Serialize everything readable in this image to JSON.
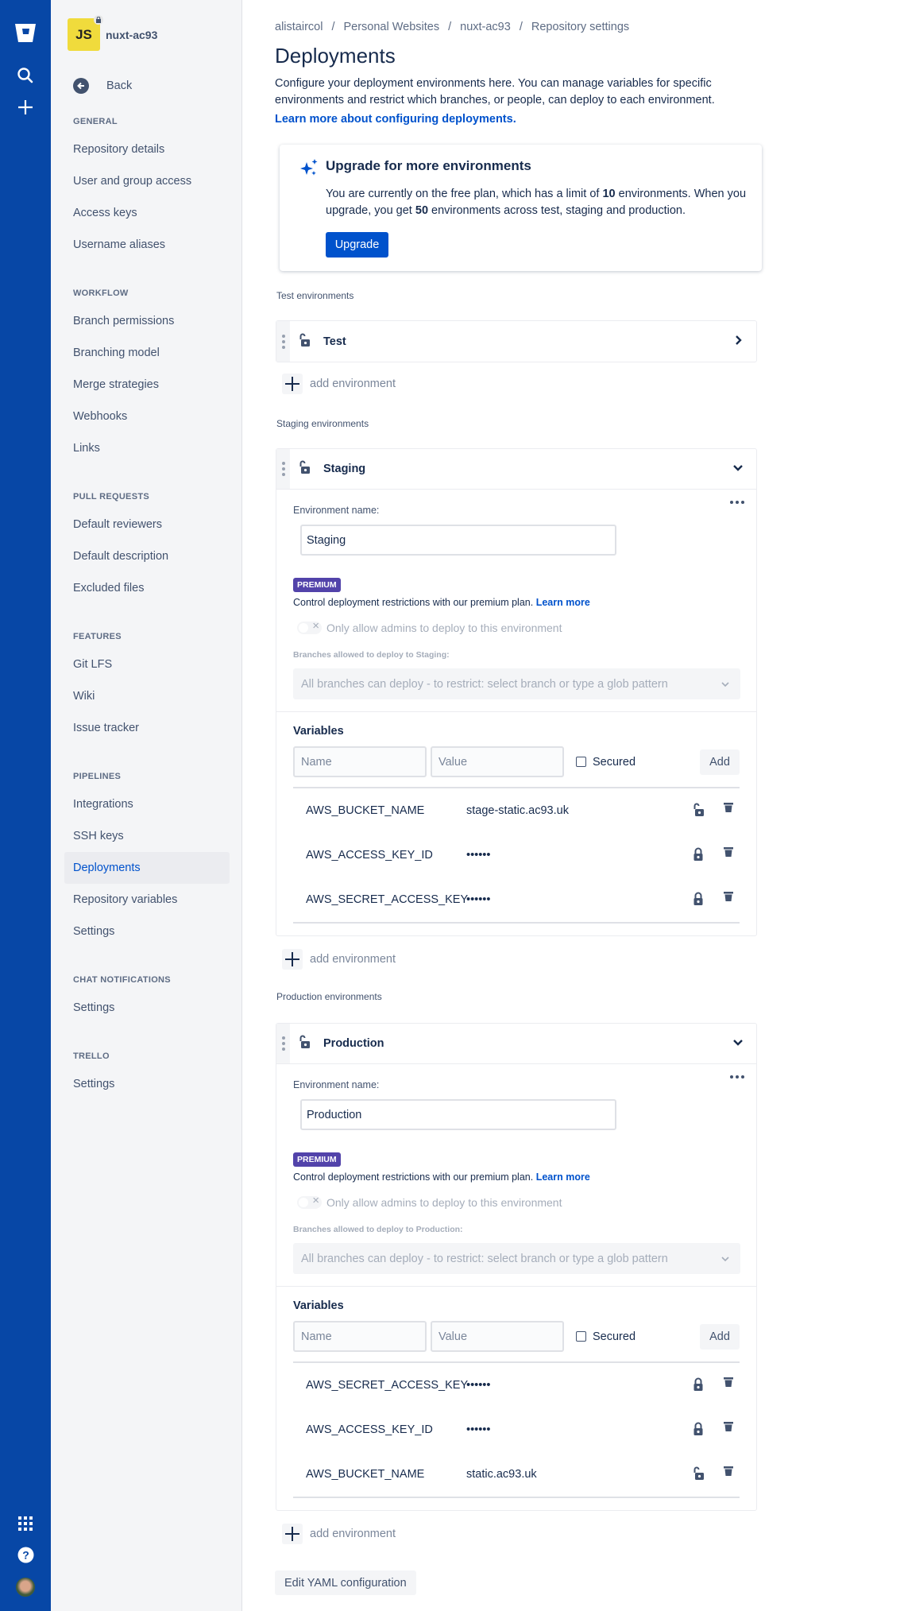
{
  "colors": {
    "global_nav": "#0747a6",
    "primary": "#0052cc",
    "premium": "#5243aa",
    "repo_avatar": "#f0db3c"
  },
  "global_nav": {
    "icons": [
      "bitbucket-logo",
      "search-icon",
      "create-plus-icon",
      "app-switcher-icon",
      "help-icon",
      "user-avatar"
    ]
  },
  "repo": {
    "avatar_text": "JS",
    "name": "nuxt-ac93",
    "private": true
  },
  "sidebar": {
    "back": "Back",
    "sections": [
      {
        "title": "GENERAL",
        "items": [
          "Repository details",
          "User and group access",
          "Access keys",
          "Username aliases"
        ]
      },
      {
        "title": "WORKFLOW",
        "items": [
          "Branch permissions",
          "Branching model",
          "Merge strategies",
          "Webhooks",
          "Links"
        ]
      },
      {
        "title": "PULL REQUESTS",
        "items": [
          "Default reviewers",
          "Default description",
          "Excluded files"
        ]
      },
      {
        "title": "FEATURES",
        "items": [
          "Git LFS",
          "Wiki",
          "Issue tracker"
        ]
      },
      {
        "title": "PIPELINES",
        "items": [
          "Integrations",
          "SSH keys",
          "Deployments",
          "Repository variables",
          "Settings"
        ]
      },
      {
        "title": "CHAT NOTIFICATIONS",
        "items": [
          "Settings"
        ]
      },
      {
        "title": "TRELLO",
        "items": [
          "Settings"
        ]
      }
    ],
    "active": "Deployments"
  },
  "breadcrumb": [
    "alistaircol",
    "Personal Websites",
    "nuxt-ac93",
    "Repository settings"
  ],
  "page": {
    "title": "Deployments",
    "description": "Configure your deployment environments here. You can manage variables for specific environments and restrict which branches, or people, can deploy to each environment.",
    "learn_more": "Learn more about configuring deployments."
  },
  "upgrade": {
    "title": "Upgrade for more environments",
    "text_1": "You are currently on the free plan, which has a limit of ",
    "limit": "10",
    "text_2": " environments. When you upgrade, you get ",
    "upgraded_limit": "50",
    "text_3": " environments across test, staging and production.",
    "button": "Upgrade"
  },
  "common": {
    "add_environment": "add environment",
    "env_name_label": "Environment name:",
    "premium": "PREMIUM",
    "premium_text": "Control deployment restrictions with our premium plan.",
    "learn_more": "Learn more",
    "admins_toggle": "Only allow admins to deploy to this environment",
    "branches_placeholder": "All branches can deploy - to restrict: select branch or type a glob pattern",
    "variables": "Variables",
    "name_placeholder": "Name",
    "value_placeholder": "Value",
    "secured": "Secured",
    "add": "Add"
  },
  "test": {
    "section": "Test environments",
    "env": {
      "name": "Test",
      "expanded": false
    }
  },
  "staging": {
    "section": "Staging environments",
    "env": {
      "name": "Staging",
      "expanded": true,
      "branches_label": "Branches allowed to deploy to Staging:",
      "admins_only": false,
      "variables": [
        {
          "name": "AWS_BUCKET_NAME",
          "value": "stage-static.ac93.uk",
          "secured": false
        },
        {
          "name": "AWS_ACCESS_KEY_ID",
          "value": "••••••",
          "secured": true
        },
        {
          "name": "AWS_SECRET_ACCESS_KEY",
          "value": "••••••",
          "secured": true
        }
      ]
    }
  },
  "production": {
    "section": "Production environments",
    "env": {
      "name": "Production",
      "expanded": true,
      "branches_label": "Branches allowed to deploy to Production:",
      "admins_only": false,
      "variables": [
        {
          "name": "AWS_SECRET_ACCESS_KEY",
          "value": "••••••",
          "secured": true
        },
        {
          "name": "AWS_ACCESS_KEY_ID",
          "value": "••••••",
          "secured": true
        },
        {
          "name": "AWS_BUCKET_NAME",
          "value": "static.ac93.uk",
          "secured": false
        }
      ]
    }
  },
  "edit_yaml": "Edit YAML configuration"
}
